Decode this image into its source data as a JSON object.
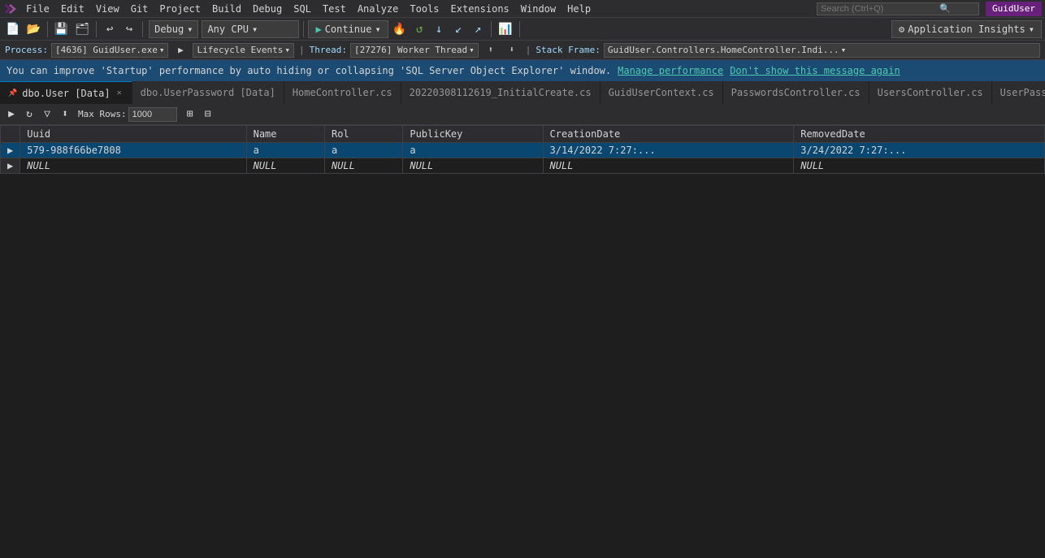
{
  "menubar": {
    "items": [
      "File",
      "Edit",
      "View",
      "Git",
      "Project",
      "Build",
      "Debug",
      "SQL",
      "Test",
      "Analyze",
      "Tools",
      "Extensions",
      "Window",
      "Help"
    ],
    "search_placeholder": "Search (Ctrl+Q)",
    "user": "GuidUser"
  },
  "toolbar1": {
    "debug_config": "Debug",
    "cpu_config": "Any CPU",
    "continue_label": "Continue",
    "app_insights_label": "Application Insights"
  },
  "toolbar2": {
    "process_label": "Process:",
    "process_value": "[4636] GuidUser.exe",
    "lifecycle_label": "Lifecycle Events",
    "thread_label": "Thread:",
    "thread_value": "[27276] Worker Thread",
    "stack_label": "Stack Frame:",
    "stack_value": "GuidUser.Controllers.HomeController.Indi..."
  },
  "notif": {
    "message": "You can improve 'Startup' performance by auto hiding or collapsing 'SQL Server Object Explorer' window.",
    "link_label": "Manage performance",
    "dismiss_label": "Don't show this message again"
  },
  "tabs": [
    {
      "id": "tab1",
      "label": "dbo.User [Data]",
      "active": true,
      "pinned": true,
      "closable": true
    },
    {
      "id": "tab2",
      "label": "dbo.UserPassword [Data]",
      "active": false,
      "closable": false
    },
    {
      "id": "tab3",
      "label": "HomeController.cs",
      "active": false,
      "closable": false
    },
    {
      "id": "tab4",
      "label": "20220308112619_InitialCreate.cs",
      "active": false,
      "closable": false
    },
    {
      "id": "tab5",
      "label": "GuidUserContext.cs",
      "active": false,
      "closable": false
    },
    {
      "id": "tab6",
      "label": "PasswordsController.cs",
      "active": false,
      "closable": false
    },
    {
      "id": "tab7",
      "label": "UsersController.cs",
      "active": false,
      "closable": false
    },
    {
      "id": "tab8",
      "label": "UserPasswordsController.cs",
      "active": false,
      "closable": false
    }
  ],
  "data_toolbar": {
    "max_rows_label": "Max Rows:",
    "max_rows_value": "1000"
  },
  "grid": {
    "columns": [
      "",
      "Uuid",
      "Name",
      "Rol",
      "PublicKey",
      "CreationDate",
      "RemovedDate"
    ],
    "rows": [
      {
        "indicator": "▶",
        "selected": true,
        "uuid": "579-988f66be7808",
        "name": "a",
        "rol": "a",
        "publickey": "a",
        "creationdate": "3/14/2022 7:27:...",
        "removeddate": "3/24/2022 7:27:..."
      },
      {
        "indicator": "▶",
        "selected": false,
        "uuid": "NULL",
        "name": "NULL",
        "rol": "NULL",
        "publickey": "NULL",
        "creationdate": "NULL",
        "removeddate": "NULL"
      }
    ]
  }
}
